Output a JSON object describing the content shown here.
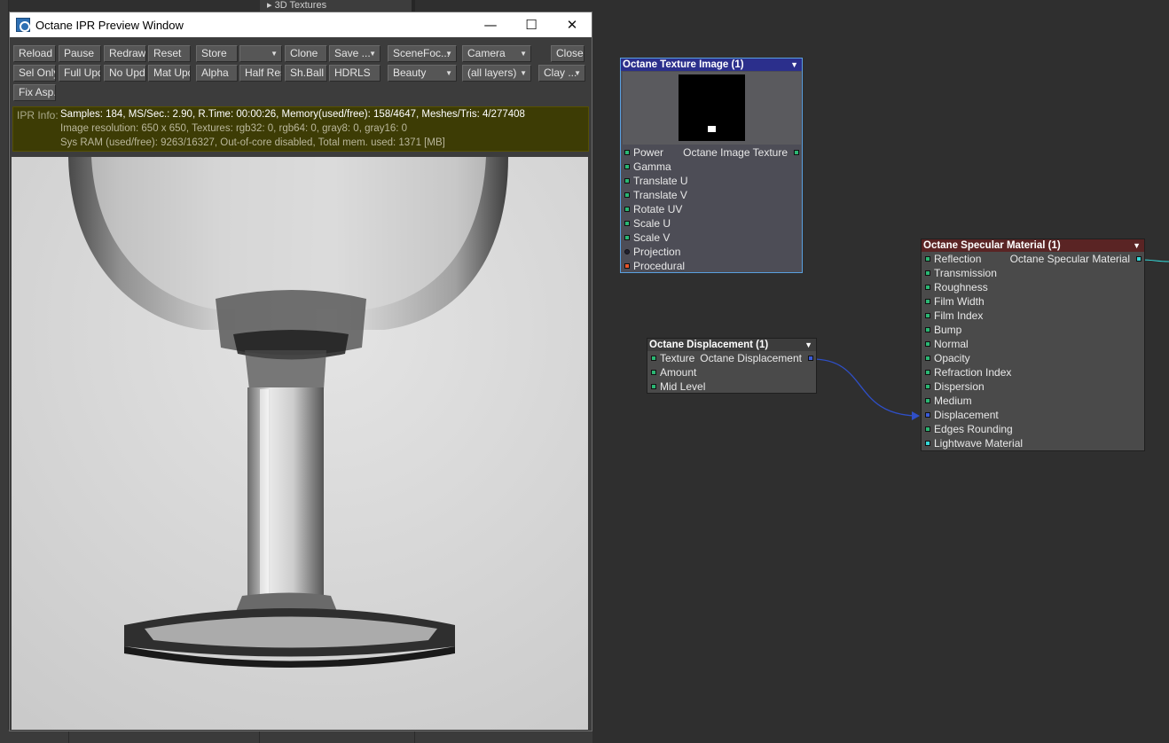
{
  "background": {
    "panel_label": "3D Textures"
  },
  "window": {
    "title": "Octane IPR Preview Window",
    "controls": {
      "minimize": "—",
      "maximize": "☐",
      "close": "✕"
    }
  },
  "toolbar": {
    "reload": "Reload",
    "pause": "Pause",
    "redraw": "Redraw",
    "reset": "Reset",
    "store": "Store",
    "store_slot": "",
    "clone": "Clone",
    "save": "Save ...",
    "scene_focus": "SceneFoc...",
    "camera": "Camera",
    "close": "Close",
    "sel_only": "Sel Only",
    "full_upd": "Full Upd.",
    "no_upd": "No Upd.",
    "mat_upd": "Mat Upd",
    "alpha": "Alpha",
    "half_res": "Half Res",
    "sh_ball": "Sh.Ball",
    "hdrls": "HDRLS",
    "beauty": "Beauty",
    "all_layers": "(all layers)",
    "clay": "Clay ...",
    "fix_asp": "Fix Asp."
  },
  "ipr_info": {
    "label": "IPR Info:",
    "line1": "Samples: 184, MS/Sec.: 2.90, R.Time: 00:00:26, Memory(used/free): 158/4647, Meshes/Tris: 4/277408",
    "line2": "Image resolution: 650 x 650, Textures: rgb32: 0, rgb64: 0, gray8: 0, gray16: 0",
    "line3": "Sys RAM (used/free): 9263/16327, Out-of-core disabled, Total mem. used: 1371  [MB]"
  },
  "nodes": {
    "texture_image": {
      "title": "Octane Texture Image (1)",
      "output": "Octane Image Texture",
      "inputs": [
        "Power",
        "Gamma",
        "Translate U",
        "Translate V",
        "Rotate UV",
        "Scale U",
        "Scale V",
        "Projection",
        "Procedural"
      ]
    },
    "displacement": {
      "title": "Octane Displacement (1)",
      "output": "Octane Displacement",
      "inputs": [
        "Texture",
        "Amount",
        "Mid Level"
      ]
    },
    "specular": {
      "title": "Octane Specular Material (1)",
      "output": "Octane Specular Material",
      "inputs": [
        "Reflection",
        "Transmission",
        "Roughness",
        "Film Width",
        "Film Index",
        "Bump",
        "Normal",
        "Opacity",
        "Refraction Index",
        "Dispersion",
        "Medium",
        "Displacement",
        "Edges Rounding",
        "Lightwave Material"
      ]
    }
  },
  "colors": {
    "pin_green": "#2bb673",
    "pin_blue": "#3a5bd9",
    "pin_dark": "#222233",
    "pin_orange": "#e8552a",
    "pin_cyan": "#35d7d7",
    "wire": "#2f4fc7"
  }
}
